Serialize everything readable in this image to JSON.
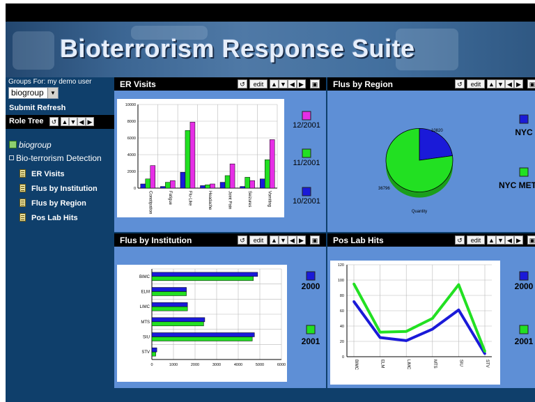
{
  "app": {
    "title": "Bioterrorism Response Suite"
  },
  "sidebar": {
    "groups_label": "Groups For: my demo user",
    "group_value": "biogroup",
    "submit_label": "Submit",
    "refresh_label": "Refresh",
    "role_tree_label": "Role Tree",
    "tree": {
      "root": "biogroup",
      "folder": "Bio-terrorism Detection",
      "items": [
        "ER Visits",
        "Flus by Institution",
        "Flus by Region",
        "Pos Lab Hits"
      ]
    }
  },
  "panels": {
    "edit_label": "edit",
    "er_visits": {
      "title": "ER Visits"
    },
    "flus_by_region": {
      "title": "Flus by Region"
    },
    "flus_by_institution": {
      "title": "Flus by Institution"
    },
    "pos_lab_hits": {
      "title": "Pos Lab Hits"
    }
  },
  "colors": {
    "blue": "#1a1ad8",
    "green": "#22e022",
    "magenta": "#e62ee6",
    "panel_bg": "#5e8fd6",
    "sidebar_bg": "#0f3f6b"
  },
  "chart_data": [
    {
      "id": "er_visits",
      "type": "bar",
      "categories": [
        "Constipation",
        "Fatigue",
        "Flu-Like",
        "Headache",
        "Joint Pain",
        "Seizures",
        "Vomiting"
      ],
      "ylim": [
        0,
        10000
      ],
      "yticks": [
        "0",
        "2000",
        "4000",
        "6000",
        "8000",
        "10000"
      ],
      "series": [
        {
          "name": "10/2001",
          "color": "#1a1ad8",
          "values": [
            500,
            200,
            1900,
            300,
            700,
            200,
            1100
          ]
        },
        {
          "name": "11/2001",
          "color": "#22e022",
          "values": [
            1100,
            700,
            6900,
            400,
            1500,
            1300,
            3400
          ]
        },
        {
          "name": "12/2001",
          "color": "#e62ee6",
          "values": [
            2700,
            900,
            7900,
            500,
            2900,
            900,
            5800
          ]
        }
      ],
      "grid": true,
      "legend": "right"
    },
    {
      "id": "flus_by_region",
      "type": "pie",
      "slices": [
        {
          "name": "NYC",
          "value": 10820,
          "color": "#1a1ad8"
        },
        {
          "name": "NYC METRO",
          "value": 36796,
          "color": "#22e022"
        }
      ],
      "slice_labels": [
        "10820",
        "36796"
      ],
      "xlabel": "Quantity",
      "legend": "right"
    },
    {
      "id": "flus_by_institution",
      "type": "bar",
      "orientation": "horizontal",
      "categories": [
        "BIMC",
        "ELM",
        "LIMC",
        "MTS",
        "SIU",
        "STV"
      ],
      "xlim": [
        0,
        6000
      ],
      "xticks": [
        "0",
        "1000",
        "2000",
        "3000",
        "4000",
        "5000",
        "6000"
      ],
      "series": [
        {
          "name": "2000",
          "color": "#1a1ad8",
          "values": [
            4900,
            1600,
            1650,
            2450,
            4750,
            230
          ]
        },
        {
          "name": "2001",
          "color": "#22e022",
          "values": [
            4700,
            1600,
            1650,
            2400,
            4650,
            180
          ]
        }
      ],
      "grid": true,
      "legend": "right"
    },
    {
      "id": "pos_lab_hits",
      "type": "line",
      "categories": [
        "BIMC",
        "ELM",
        "LIMC",
        "MTS",
        "SIU",
        "STV"
      ],
      "ylim": [
        0,
        120
      ],
      "yticks": [
        "0",
        "20",
        "40",
        "60",
        "80",
        "100",
        "120"
      ],
      "series": [
        {
          "name": "2000",
          "color": "#1a1ad8",
          "values": [
            72,
            25,
            21,
            36,
            61,
            4
          ]
        },
        {
          "name": "2001",
          "color": "#22e022",
          "values": [
            95,
            32,
            33,
            50,
            94,
            7
          ]
        }
      ],
      "grid": true,
      "legend": "right"
    }
  ]
}
